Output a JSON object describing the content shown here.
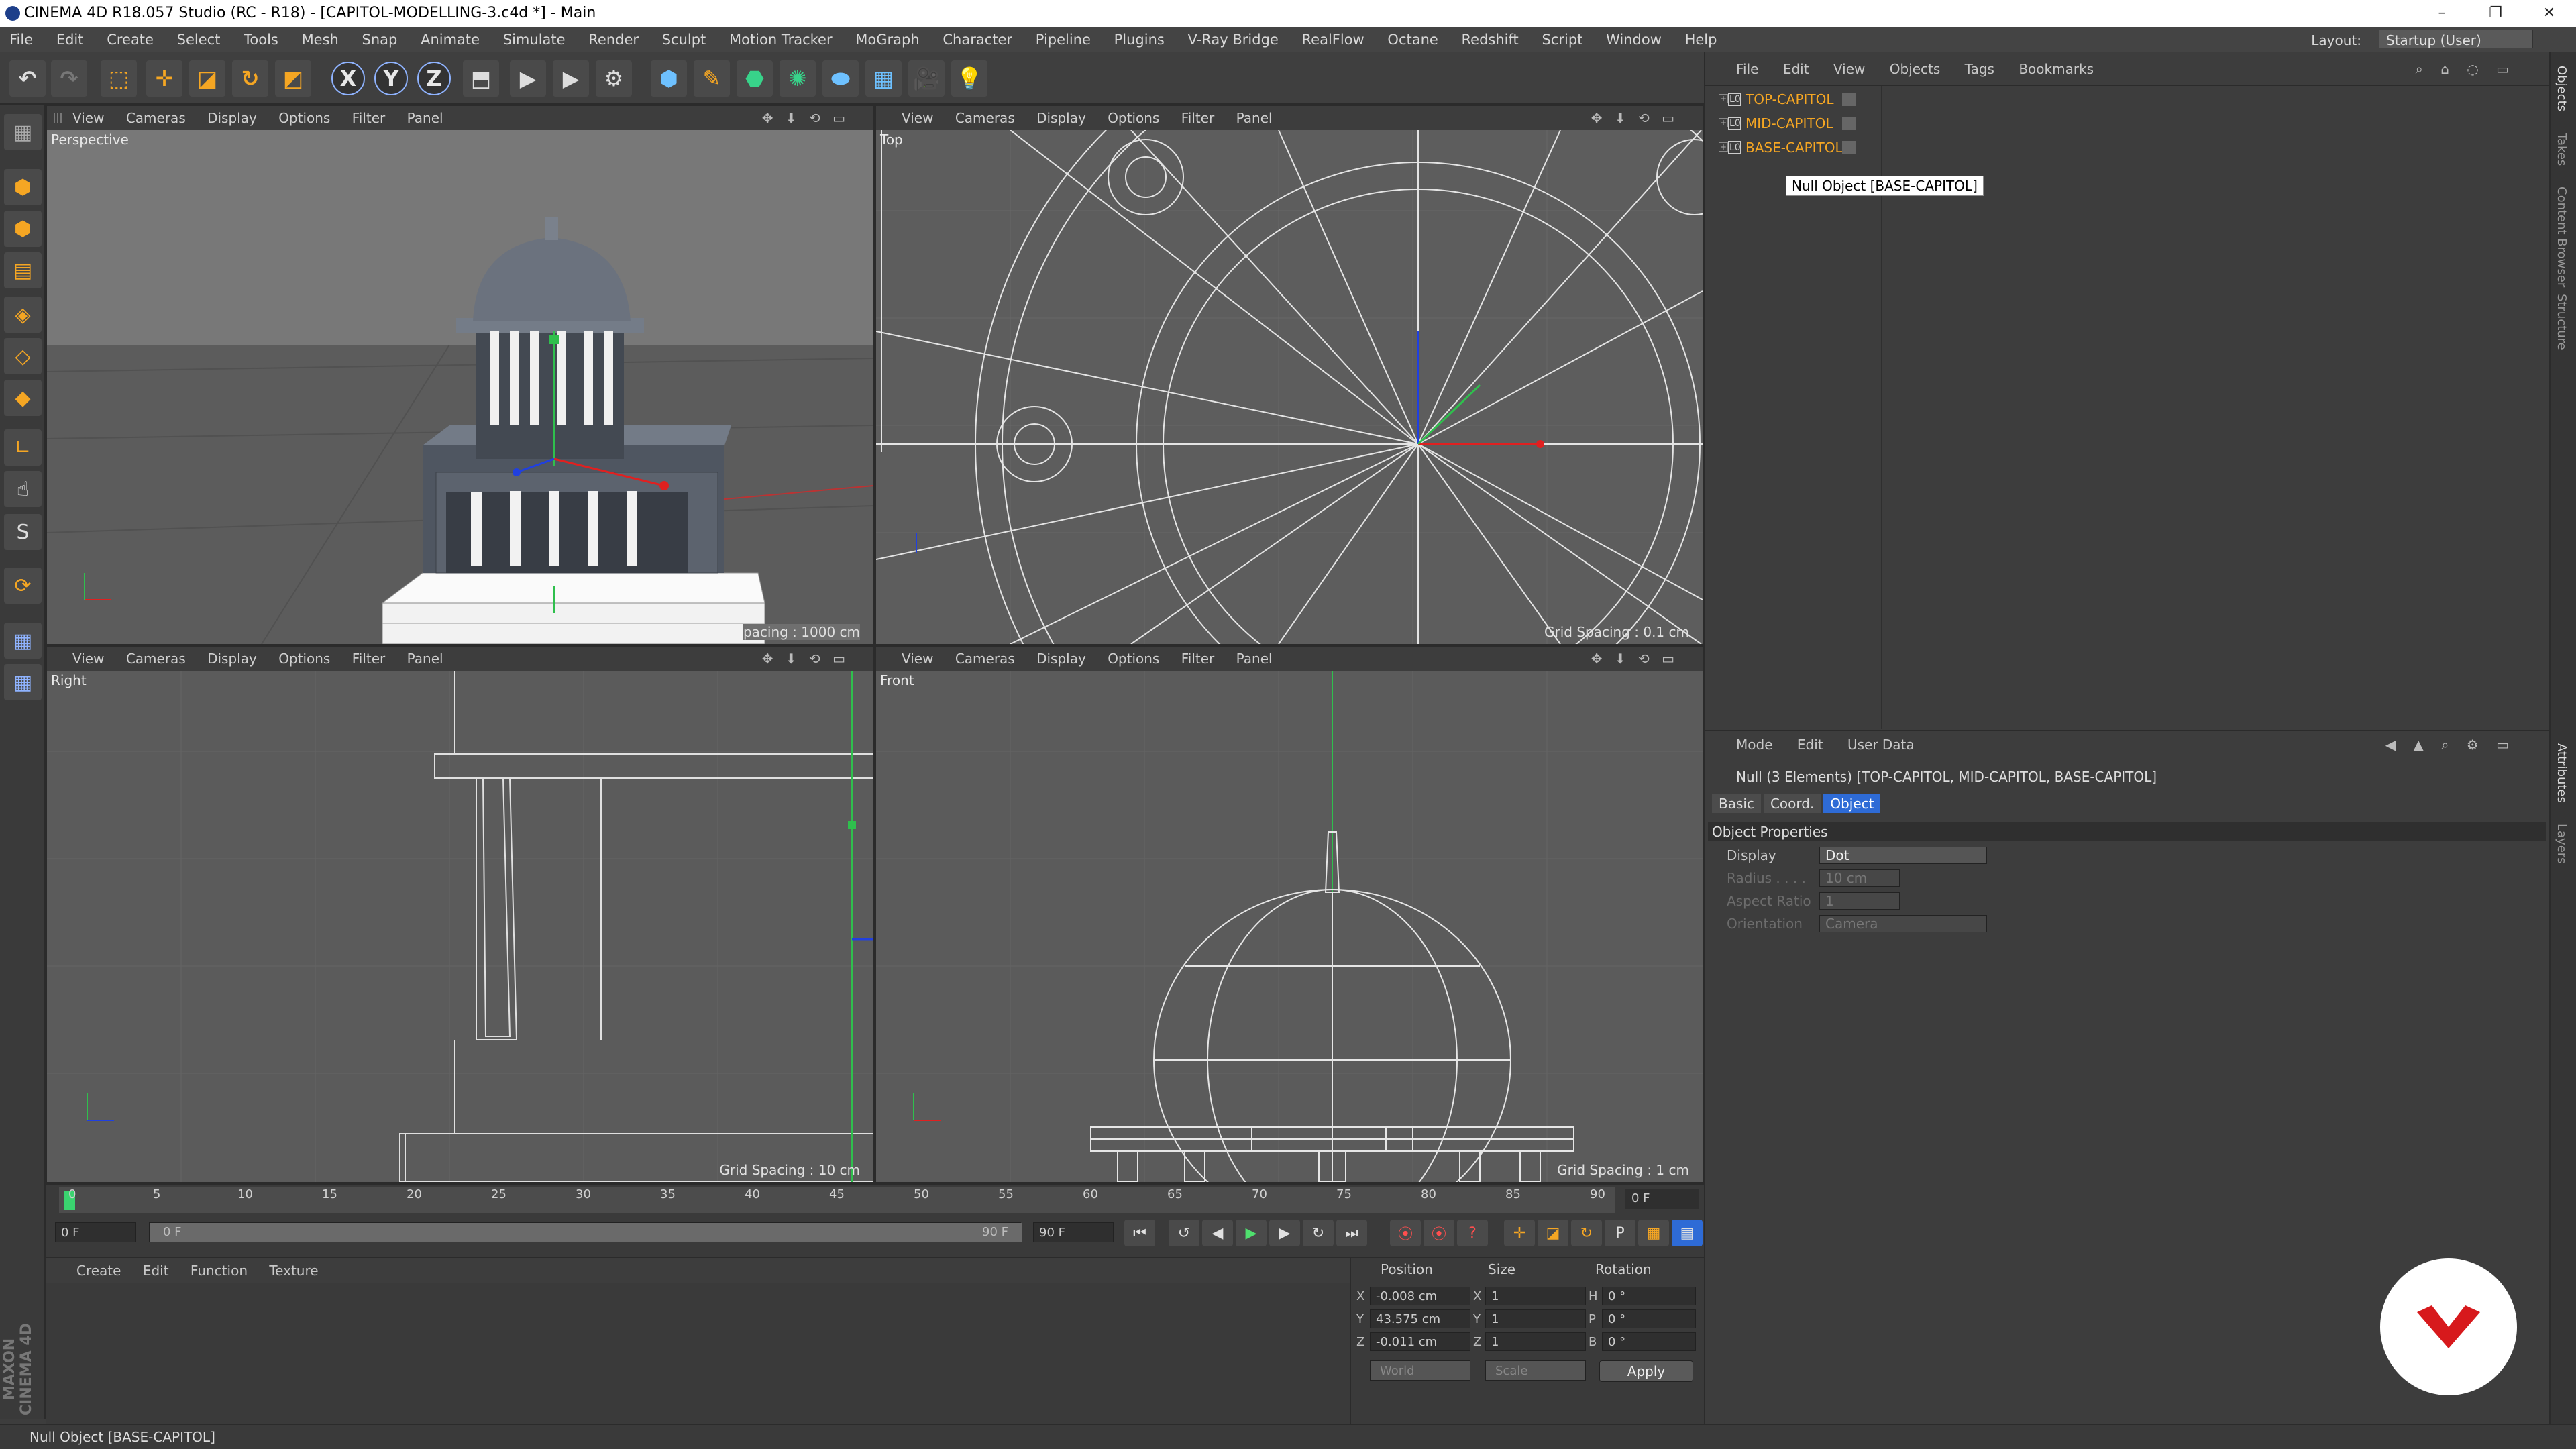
{
  "window": {
    "title": "CINEMA 4D R18.057 Studio (RC - R18) - [CAPITOL-MODELLING-3.c4d *] - Main",
    "minimize": "–",
    "restore": "❐",
    "close": "✕"
  },
  "menubar": {
    "items": [
      "File",
      "Edit",
      "Create",
      "Select",
      "Tools",
      "Mesh",
      "Snap",
      "Animate",
      "Simulate",
      "Render",
      "Sculpt",
      "Motion Tracker",
      "MoGraph",
      "Character",
      "Pipeline",
      "Plugins",
      "V-Ray Bridge",
      "RealFlow",
      "Octane",
      "Redshift",
      "Script",
      "Window",
      "Help"
    ],
    "layout_label": "Layout:",
    "layout_value": "Startup (User)"
  },
  "toolbar": {
    "undo": "↶",
    "redo": "↷",
    "axis_x": "X",
    "axis_y": "Y",
    "axis_z": "Z"
  },
  "viewports": {
    "menu": [
      "View",
      "Cameras",
      "Display",
      "Options",
      "Filter",
      "Panel"
    ],
    "nav_icons": "✥ ⬇ ⟲ ▭",
    "perspective": {
      "label": "Perspective",
      "grid": "pacing : 1000 cm"
    },
    "top": {
      "label": "Top",
      "grid": "Grid Spacing : 0.1 cm"
    },
    "right": {
      "label": "Right",
      "grid": "Grid Spacing : 10 cm"
    },
    "front": {
      "label": "Front",
      "grid": "Grid Spacing : 1 cm"
    }
  },
  "timeline": {
    "ticks": [
      "0",
      "5",
      "10",
      "15",
      "20",
      "25",
      "30",
      "35",
      "40",
      "45",
      "50",
      "55",
      "60",
      "65",
      "70",
      "75",
      "80",
      "85",
      "90"
    ],
    "current_frame": "0 F",
    "start_frame": "0 F",
    "slider_start": "0 F",
    "slider_end": "90 F",
    "end_frame": "90 F",
    "end_display": "0 F"
  },
  "material_panel": {
    "menu": [
      "Create",
      "Edit",
      "Function",
      "Texture"
    ]
  },
  "coordinates": {
    "headers": [
      "Position",
      "Size",
      "Rotation"
    ],
    "rows": [
      {
        "axis": "X",
        "pos": "-0.008 cm",
        "size_axis": "X",
        "size": "1",
        "rot_axis": "H",
        "rot": "0 °"
      },
      {
        "axis": "Y",
        "pos": "43.575 cm",
        "size_axis": "Y",
        "size": "1",
        "rot_axis": "P",
        "rot": "0 °"
      },
      {
        "axis": "Z",
        "pos": "-0.011 cm",
        "size_axis": "Z",
        "size": "1",
        "rot_axis": "B",
        "rot": "0 °"
      }
    ],
    "mode1": "World",
    "mode2": "Scale",
    "apply": "Apply"
  },
  "objects_panel": {
    "menu": [
      "File",
      "Edit",
      "View",
      "Objects",
      "Tags",
      "Bookmarks"
    ],
    "items": [
      {
        "name": "TOP-CAPITOL"
      },
      {
        "name": "MID-CAPITOL"
      },
      {
        "name": "BASE-CAPITOL"
      }
    ],
    "tooltip": "Null Object [BASE-CAPITOL]"
  },
  "attributes_panel": {
    "menu": [
      "Mode",
      "Edit",
      "User Data"
    ],
    "info": "Null (3 Elements) [TOP-CAPITOL, MID-CAPITOL, BASE-CAPITOL]",
    "tabs": [
      "Basic",
      "Coord.",
      "Object"
    ],
    "active_tab": "Object",
    "section": "Object Properties",
    "props": [
      {
        "label": "Display",
        "value": "Dot"
      },
      {
        "label": "Radius . . . .",
        "value": "10 cm"
      },
      {
        "label": "Aspect Ratio",
        "value": "1"
      },
      {
        "label": "Orientation",
        "value": "Camera"
      }
    ]
  },
  "side_tabs": [
    "Objects",
    "Takes",
    "Content Browser",
    "Structure",
    "Attributes",
    "Layers"
  ],
  "status": "Null Object [BASE-CAPITOL]",
  "maxon_logo": "MAXON CINEMA 4D",
  "colors": {
    "accent": "#f5a623",
    "selection": "#2e6bd6",
    "logo_red": "#d7191c"
  }
}
